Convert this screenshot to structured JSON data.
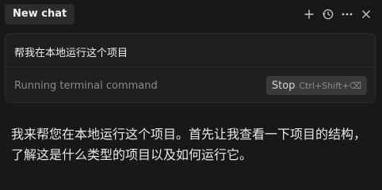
{
  "header": {
    "tab_title": "New chat",
    "icons": [
      "plus-icon",
      "history-icon",
      "more-icon",
      "close-icon"
    ]
  },
  "composer": {
    "query": "帮我在本地运行这个项目",
    "status": "Running terminal command",
    "stop_label": "Stop",
    "stop_shortcut": "Ctrl+Shift+⌫"
  },
  "message": {
    "text": "我来帮您在本地运行这个项目。首先让我查看一下项目的结构，了解这是什么类型的项目以及如何运行它。"
  }
}
